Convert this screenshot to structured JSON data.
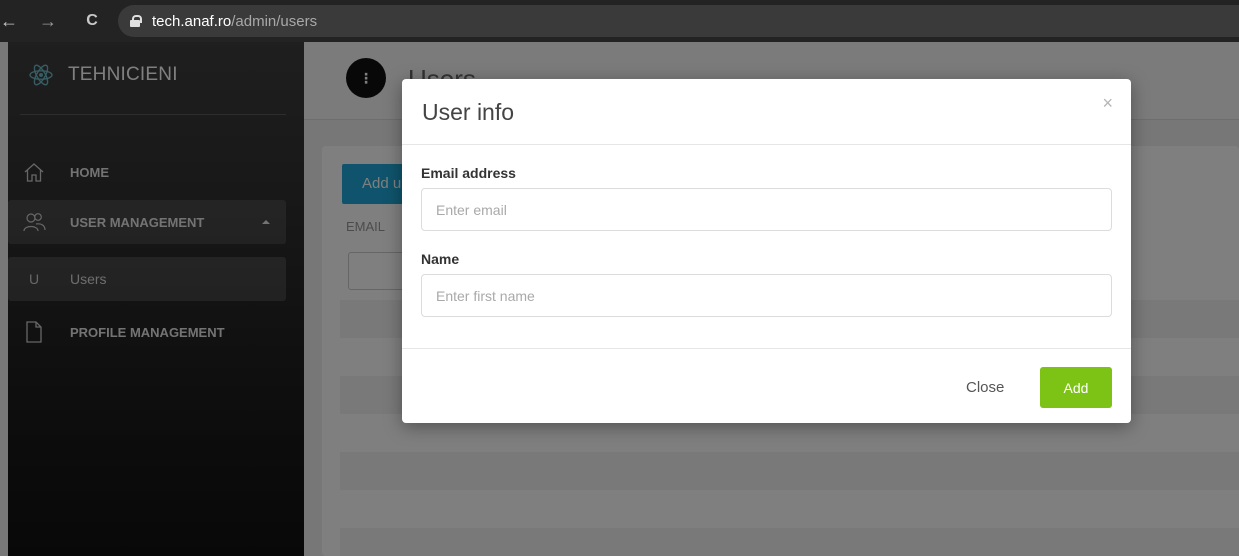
{
  "browser": {
    "url_domain": "tech.anaf.ro",
    "url_path": "/admin/users"
  },
  "sidebar": {
    "brand": "TEHNICIENI",
    "items": [
      {
        "label": "HOME",
        "icon": "home-icon"
      },
      {
        "label": "USER MANAGEMENT",
        "icon": "users-icon",
        "expanded": true
      },
      {
        "label": "Users",
        "letter": "U",
        "active": true
      },
      {
        "label": "PROFILE MANAGEMENT",
        "icon": "document-icon"
      }
    ]
  },
  "main": {
    "page_title": "Users",
    "header_icon": "⋮",
    "add_user_label": "Add u",
    "email_column": "EMAIL"
  },
  "modal": {
    "title": "User info",
    "close_symbol": "×",
    "email_label": "Email address",
    "email_placeholder": "Enter email",
    "email_value": "",
    "name_label": "Name",
    "name_placeholder": "Enter first name",
    "name_value": "",
    "close_button": "Close",
    "add_button": "Add"
  },
  "colors": {
    "accent_green": "#7dc316",
    "accent_blue": "#1ea8d8"
  }
}
